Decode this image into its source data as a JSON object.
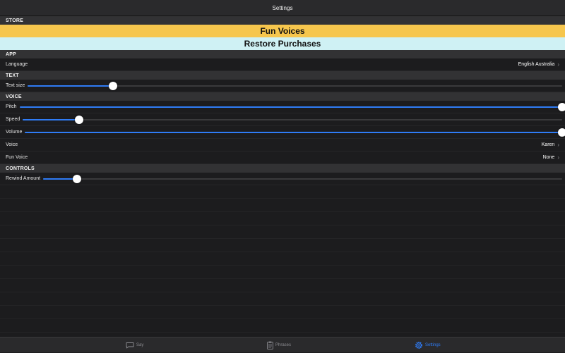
{
  "navbar": {
    "title": "Settings"
  },
  "store": {
    "header": "STORE",
    "fun_voices": "Fun Voices",
    "restore": "Restore Purchases",
    "colors": {
      "fun_voices_bg": "#f6c64d",
      "restore_bg": "#cff1f4"
    }
  },
  "app": {
    "header": "APP",
    "language_label": "Language",
    "language_value": "English Australia"
  },
  "text": {
    "header": "TEXT",
    "text_size_label": "Text size",
    "text_size_value": 0.16
  },
  "voice": {
    "header": "VOICE",
    "pitch_label": "Pitch",
    "pitch_value": 1.0,
    "speed_label": "Speed",
    "speed_value": 0.105,
    "volume_label": "Volume",
    "volume_value": 1.0,
    "voice_label": "Voice",
    "voice_value": "Karen",
    "fun_voice_label": "Fun Voice",
    "fun_voice_value": "None"
  },
  "controls": {
    "header": "CONTROLS",
    "rewind_label": "Rewind Amount",
    "rewind_value": 0.065
  },
  "tabs": [
    {
      "label": "Say",
      "icon": "speech-bubble-icon",
      "active": false
    },
    {
      "label": "Phrases",
      "icon": "clipboard-icon",
      "active": false
    },
    {
      "label": "Settings",
      "icon": "gear-icon",
      "active": true
    }
  ],
  "accent_color": "#2f7cf6"
}
